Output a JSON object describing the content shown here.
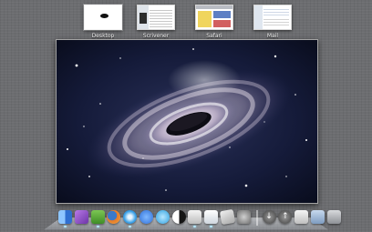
{
  "spaces": [
    {
      "id": "desktop",
      "label": "Desktop",
      "active": true
    },
    {
      "id": "scrivener",
      "label": "Scrivener",
      "active": false
    },
    {
      "id": "safari",
      "label": "Safari",
      "active": false
    },
    {
      "id": "mail",
      "label": "Mail",
      "active": false
    }
  ],
  "desktop_preview": {
    "wallpaper": "galaxy-wallpaper"
  },
  "dock": {
    "items": [
      {
        "name": "finder-icon",
        "color": "#3a7fd6",
        "running": true
      },
      {
        "name": "itunes-store-icon",
        "color": "#9a57c9",
        "running": false
      },
      {
        "name": "evernote-icon",
        "color": "#5fae3d",
        "running": true
      },
      {
        "name": "firefox-icon",
        "color": "#e37b2a",
        "running": false
      },
      {
        "name": "safari-icon",
        "color": "#3aa0e6",
        "running": true
      },
      {
        "name": "app-store-icon",
        "color": "#2f6fd8",
        "running": false
      },
      {
        "name": "music-icon",
        "color": "#2da0e0",
        "running": false
      },
      {
        "name": "yin-yang-icon",
        "color": "#222222",
        "running": false
      },
      {
        "name": "scrivener-icon",
        "color": "#d7d7d7",
        "running": true
      },
      {
        "name": "mail-icon",
        "color": "#e9e9e9",
        "running": true
      },
      {
        "name": "preview-icon",
        "color": "#c9c9c9",
        "running": false
      },
      {
        "name": "system-preferences-icon",
        "color": "#8a8a8a",
        "running": false
      },
      {
        "name": "download-arrow-icon",
        "color": "#7a7a7a",
        "running": false
      },
      {
        "name": "upload-arrow-icon",
        "color": "#7a7a7a",
        "running": false
      },
      {
        "name": "document-icon",
        "color": "#d2d2d2",
        "running": false
      },
      {
        "name": "folder-icon",
        "color": "#9fb8d6",
        "running": false
      },
      {
        "name": "trash-icon",
        "color": "#a9abae",
        "running": false
      }
    ]
  }
}
